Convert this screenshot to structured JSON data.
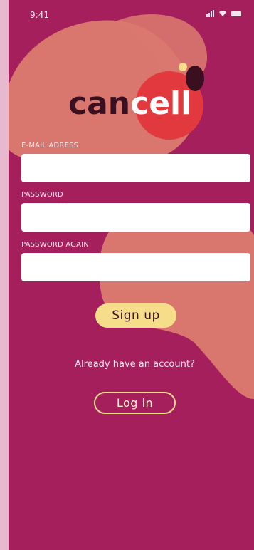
{
  "status_bar": {
    "time": "9:41"
  },
  "brand": {
    "part1": "can",
    "part2": "cell"
  },
  "form": {
    "email_label": "E-MAIL ADRESS",
    "email_value": "",
    "password_label": "PASSWORD",
    "password_value": "",
    "password_again_label": "PASSWORD AGAIN",
    "password_again_value": ""
  },
  "actions": {
    "signup_label": "Sign up",
    "already_text": "Already have an account?",
    "login_label": "Log in"
  },
  "colors": {
    "background": "#a51f5c",
    "blob": "#d97a73",
    "accent_red": "#e2393f",
    "button_yellow": "#f6dd8a"
  }
}
